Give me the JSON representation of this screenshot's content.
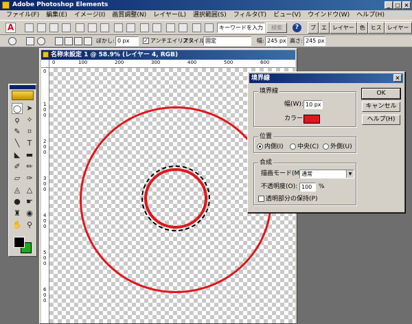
{
  "app": {
    "title": "Adobe Photoshop Elements"
  },
  "menu": [
    "ファイル(F)",
    "編集(E)",
    "イメージ(I)",
    "画質調整(N)",
    "レイヤー(L)",
    "選択範囲(S)",
    "フィルタ(T)",
    "ビュー(V)",
    "ウインドウ(W)",
    "ヘルプ(H)"
  ],
  "shortcuts": {
    "search_value": "キーワードを入力",
    "search_button": "検索",
    "palette_tabs": [
      "ブ",
      "エ",
      "レイヤー",
      "色",
      "ヒス",
      "レイヤー"
    ]
  },
  "options": {
    "feather_label": "ぼかし:",
    "feather_value": "0 px",
    "antialias_label": "アンチエイリアス",
    "style_label": "スタイル:",
    "style_value": "固定",
    "width_label": "幅:",
    "width_value": "245 px",
    "height_label": "高さ:",
    "height_value": "245 px"
  },
  "document": {
    "title": "名称未設定 1 @ 58.9% (レイヤー 4, RGB)",
    "ruler_h": [
      "0",
      "100",
      "200",
      "300",
      "400",
      "500",
      "600"
    ],
    "ruler_v": [
      "0",
      "1",
      "0",
      "0",
      "2",
      "0",
      "0",
      "3",
      "0",
      "0",
      "4",
      "0",
      "0",
      "5",
      "0",
      "0",
      "6",
      "0",
      "0"
    ]
  },
  "dialog": {
    "title": "境界線",
    "stroke_group": "境界線",
    "width_label": "幅(W):",
    "width_value": "10 px",
    "color_label": "カラー:",
    "color_value": "#e0161c",
    "position_group": "位置",
    "pos_inside": "内側(I)",
    "pos_center": "中央(C)",
    "pos_outside": "外側(U)",
    "blend_group": "合成",
    "mode_label": "描画モード(M):",
    "mode_value": "通常",
    "opacity_label": "不透明度(O):",
    "opacity_value": "100",
    "opacity_unit": "%",
    "preserve_label": "透明部分の保持(P)",
    "ok": "OK",
    "cancel": "キャンセル",
    "help": "ヘルプ(H)"
  },
  "colors": {
    "foreground": "#000000",
    "background": "#1da81d",
    "stroke": "#e0161c"
  }
}
